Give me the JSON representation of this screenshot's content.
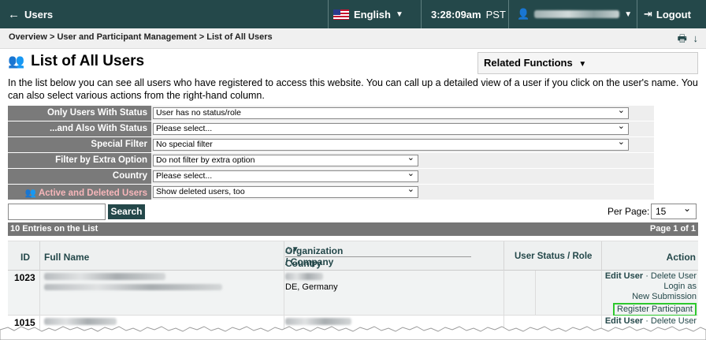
{
  "topbar": {
    "back_label": "Users",
    "language": "English",
    "time": "3:28:09am",
    "timezone": "PST",
    "logout_label": "Logout"
  },
  "breadcrumb": "Overview > User and Participant Management > List of All Users",
  "page_title": "List of All Users",
  "related_functions": "Related Functions",
  "intro": "In the list below you can see all users who have registered to access this website. You can call up a detailed view of a user if you click on the user's name. You can also select various actions from the right-hand column.",
  "filters": [
    {
      "label": "Only Users With Status",
      "value": "User has no status/role"
    },
    {
      "label": "...and Also With Status",
      "value": "Please select..."
    },
    {
      "label": "Special Filter",
      "value": "No special filter"
    },
    {
      "label": "Filter by Extra Option",
      "value": "Do not filter by extra option"
    },
    {
      "label": "Country",
      "value": "Please select..."
    },
    {
      "label": "Active and Deleted Users",
      "value": "Show deleted users, too"
    }
  ],
  "search": {
    "button": "Search",
    "placeholder": ""
  },
  "per_page": {
    "label": "Per Page:",
    "value": "15"
  },
  "info": {
    "entries": "10 Entries on the List",
    "page": "Page 1 of 1"
  },
  "table": {
    "headers": {
      "id": "ID",
      "full_name": "Full Name",
      "organization": "Organization / Company",
      "country": "Country",
      "status": "User Status / Role",
      "action": "Action"
    },
    "rows": [
      {
        "id": "1023",
        "country": "DE, Germany",
        "actions": {
          "edit": "Edit User",
          "sep": " · ",
          "delete": "Delete User",
          "login": "Login as",
          "new_submission": "New Submission",
          "register": "Register Participant"
        }
      },
      {
        "id": "1015",
        "actions": {
          "edit": "Edit User",
          "sep": " · ",
          "delete": "Delete User"
        }
      }
    ]
  },
  "colors": {
    "header_bg": "#24484a",
    "filter_label_bg": "#7a7a7a",
    "highlight": "#2ec82e"
  }
}
